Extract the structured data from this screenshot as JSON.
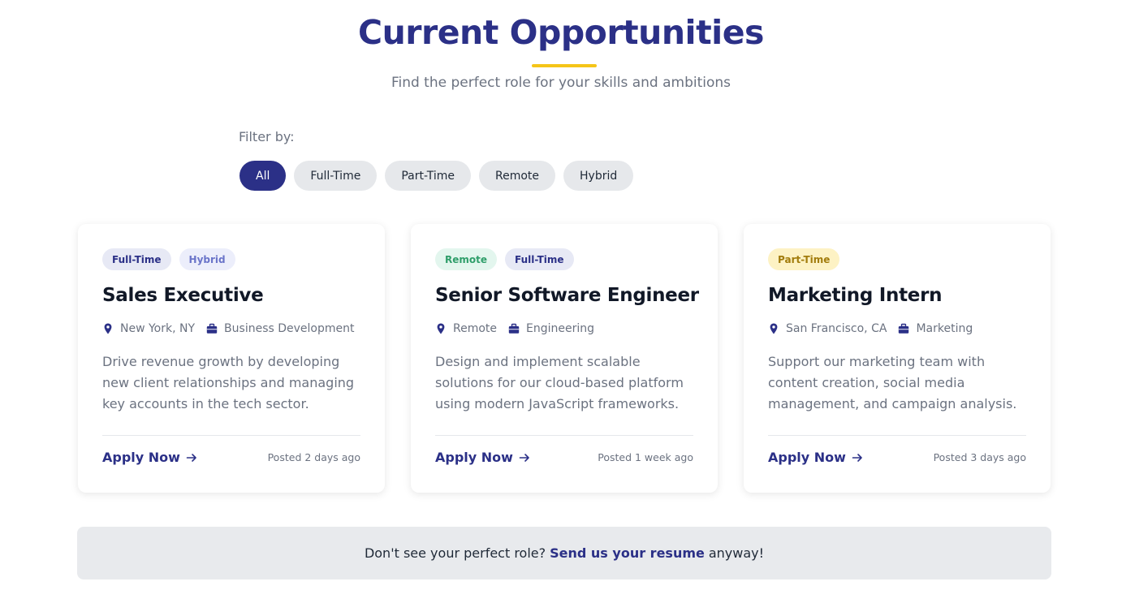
{
  "header": {
    "title": "Current Opportunities",
    "subtitle": "Find the perfect role for your skills and ambitions"
  },
  "filters": {
    "label": "Filter by:",
    "options": [
      "All",
      "Full-Time",
      "Part-Time",
      "Remote",
      "Hybrid"
    ],
    "selected": "All"
  },
  "colors": {
    "primary": "#2b3087",
    "accent_underline": "#f5c518",
    "tag_fulltime_bg": "#e7e9f5",
    "tag_fulltime_text": "#2b3087",
    "tag_hybrid_bg": "#eceefb",
    "tag_hybrid_text": "#6a74c9",
    "tag_remote_bg": "#e3f6ee",
    "tag_remote_text": "#2f9e6a",
    "tag_parttime_bg": "#fdf2c4",
    "tag_parttime_text": "#a27c0c"
  },
  "jobs": [
    {
      "tags": [
        {
          "label": "Full-Time",
          "kind": "fulltime"
        },
        {
          "label": "Hybrid",
          "kind": "hybrid"
        }
      ],
      "title": "Sales Executive",
      "location": "New York, NY",
      "department": "Business Development",
      "description": "Drive revenue growth by developing new client relationships and managing key accounts in the tech sector.",
      "apply_label": "Apply Now",
      "posted": "Posted 2 days ago"
    },
    {
      "tags": [
        {
          "label": "Remote",
          "kind": "remote"
        },
        {
          "label": "Full-Time",
          "kind": "fulltime"
        }
      ],
      "title": "Senior Software Engineer",
      "location": "Remote",
      "department": "Engineering",
      "description": "Design and implement scalable solutions for our cloud-based platform using modern JavaScript frameworks.",
      "apply_label": "Apply Now",
      "posted": "Posted 1 week ago"
    },
    {
      "tags": [
        {
          "label": "Part-Time",
          "kind": "parttime"
        }
      ],
      "title": "Marketing Intern",
      "location": "San Francisco, CA",
      "department": "Marketing",
      "description": "Support our marketing team with content creation, social media management, and campaign analysis.",
      "apply_label": "Apply Now",
      "posted": "Posted 3 days ago"
    }
  ],
  "icons": {
    "location": "map-pin-icon",
    "department": "briefcase-icon",
    "apply": "arrow-right-icon"
  },
  "resume_banner": {
    "prefix": "Don't see your perfect role?",
    "link_label": "Send us your resume",
    "suffix": "anyway!"
  }
}
